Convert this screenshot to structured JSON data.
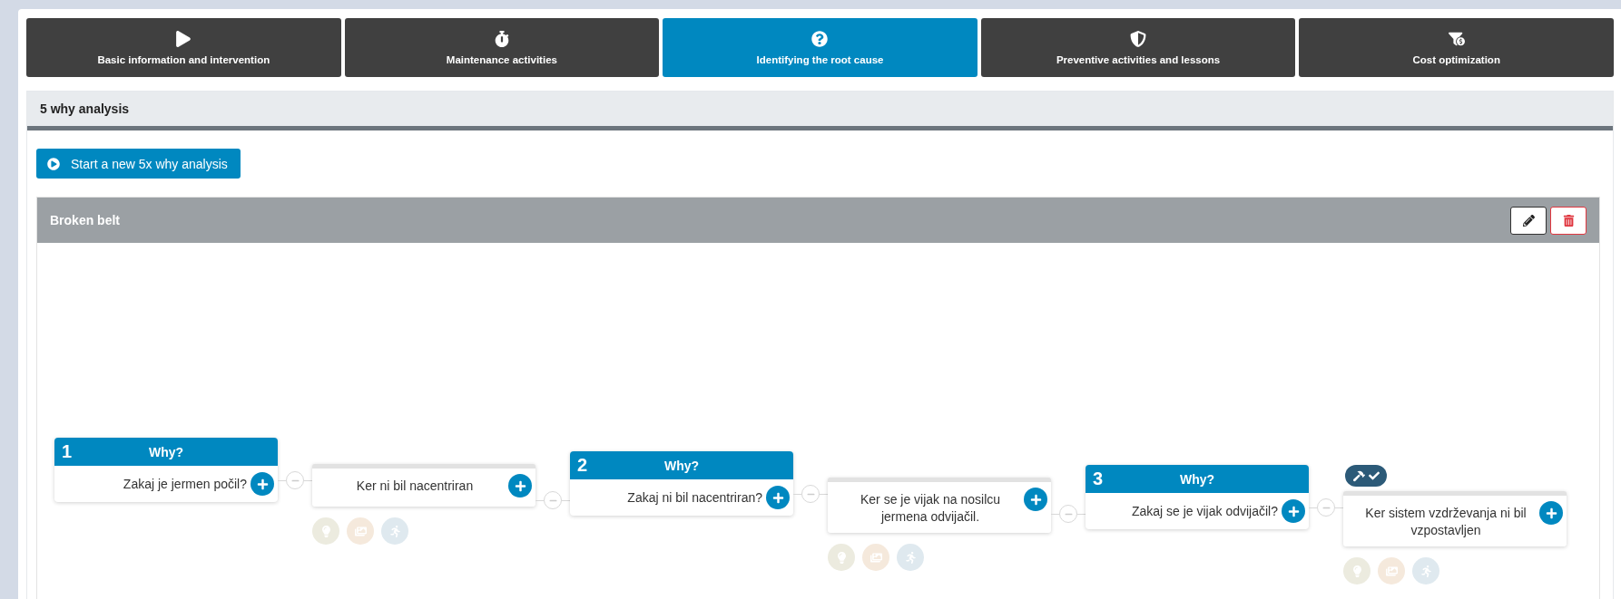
{
  "tabs": [
    {
      "label": "Basic information and intervention",
      "selected": false
    },
    {
      "label": "Maintenance activities",
      "selected": false
    },
    {
      "label": "Identifying the root cause",
      "selected": true
    },
    {
      "label": "Preventive activities and lessons",
      "selected": false
    },
    {
      "label": "Cost optimization",
      "selected": false
    }
  ],
  "section": {
    "title": "5 why analysis"
  },
  "start_button": {
    "label": "Start a new 5x why analysis"
  },
  "analysis": {
    "title": "Broken belt",
    "steps": [
      {
        "kind": "why",
        "number": "1",
        "header": "Why?",
        "text": "Zakaj je jermen počil?"
      },
      {
        "kind": "answer",
        "text": "Ker ni bil nacentriran",
        "root_cause": false
      },
      {
        "kind": "why",
        "number": "2",
        "header": "Why?",
        "text": "Zakaj ni bil nacentriran?"
      },
      {
        "kind": "answer",
        "text": "Ker se je vijak na nosilcu jermena odvijačil.",
        "root_cause": false
      },
      {
        "kind": "why",
        "number": "3",
        "header": "Why?",
        "text": "Zakaj se je vijak odvijačil?"
      },
      {
        "kind": "answer",
        "text": "Ker sistem vzdrževanja ni bil vzpostavljen",
        "root_cause": true
      }
    ]
  }
}
